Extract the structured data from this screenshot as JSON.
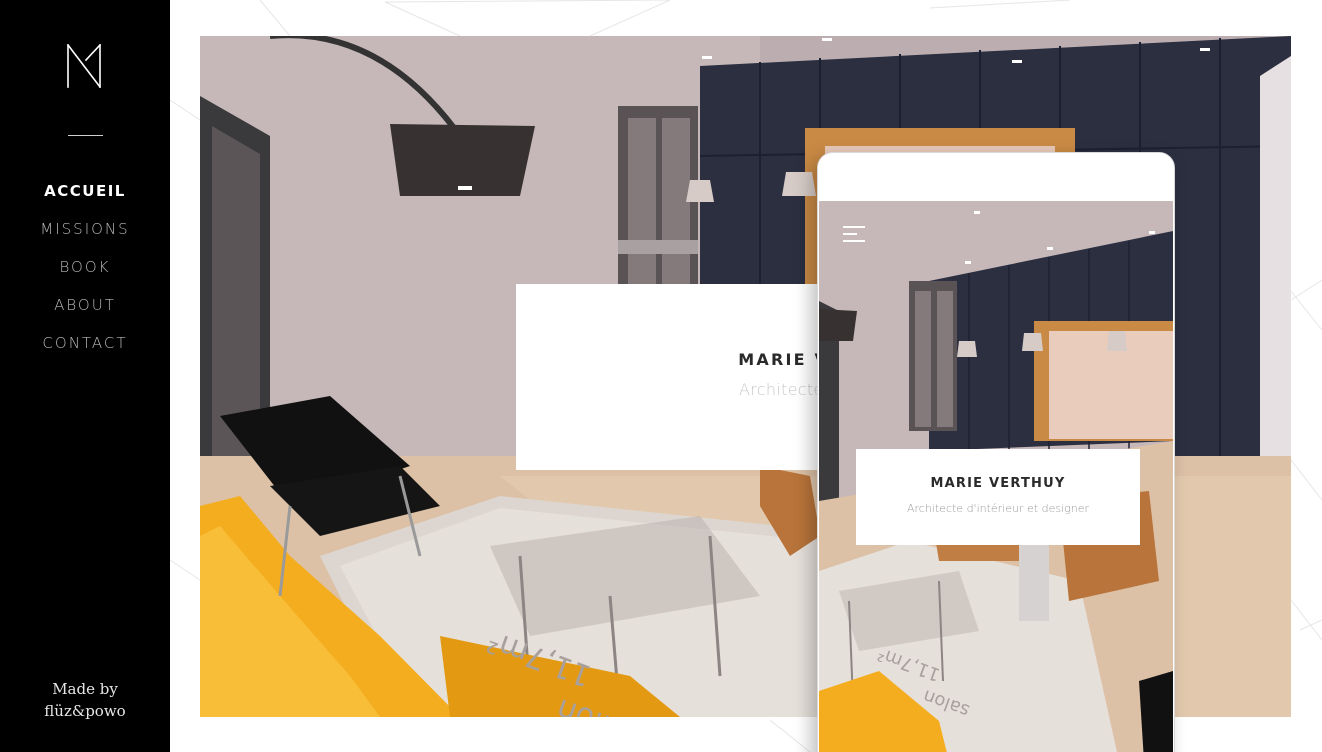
{
  "brand": {
    "logo_icon": "monogram-logo-icon"
  },
  "nav": {
    "items": [
      {
        "label": "ACCUEIL",
        "active": true
      },
      {
        "label": "MISSIONS",
        "active": false
      },
      {
        "label": "BOOK",
        "active": false
      },
      {
        "label": "ABOUT",
        "active": false
      },
      {
        "label": "CONTACT",
        "active": false
      }
    ]
  },
  "credit": {
    "line1": "Made by",
    "line2": "flüz&powo"
  },
  "hero": {
    "name": "MARIE VERTHUY",
    "subtitle": "Architecte d'intérieur et d"
  },
  "phone": {
    "name": "MARIE VERTHUY",
    "subtitle": "Architecte d'intérieur et designer",
    "menu_icon": "hamburger-menu-icon"
  },
  "rug_text": {
    "line1": "salon",
    "line2": "11,7m²"
  },
  "colors": {
    "sidebar_bg": "#000000",
    "nav_active": "#ffffff",
    "nav_inactive": "#b9b9b9",
    "wall": "#c3b4b6",
    "cabinet": "#2e3243",
    "sofa": "#f5b120",
    "floor": "#e0c4a8"
  }
}
